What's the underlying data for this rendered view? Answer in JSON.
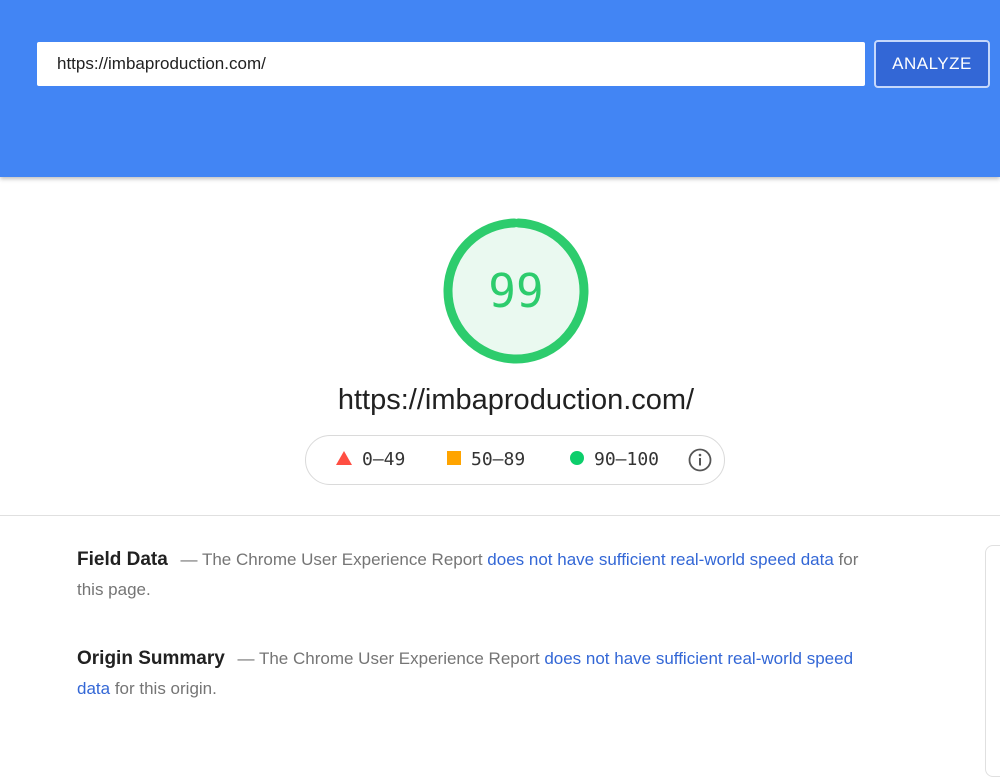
{
  "search": {
    "url_value": "https://imbaproduction.com/",
    "analyze_label": "ANALYZE"
  },
  "score": {
    "value": "99",
    "fraction": 0.99,
    "url": "https://imbaproduction.com/",
    "color": "#0cce6b"
  },
  "legend": {
    "items": [
      {
        "label": "0–49",
        "icon": "triangle-icon",
        "color": "#ff4e42"
      },
      {
        "label": "50–89",
        "icon": "square-icon",
        "color": "#ffa400"
      },
      {
        "label": "90–100",
        "icon": "circle-icon",
        "color": "#0cce6b"
      }
    ],
    "info_icon": "info-icon"
  },
  "field_data": {
    "title": "Field Data",
    "text_before": " — The Chrome User Experience Report ",
    "link": "does not have sufficient real-world speed data",
    "text_after": " for this page."
  },
  "origin_summary": {
    "title": "Origin Summary",
    "text_before": " — The Chrome User Experience Report ",
    "link": "does not have sufficient real-world speed data",
    "text_after": " for this origin."
  },
  "colors": {
    "header": "#4285f4",
    "button": "#3367d6",
    "link": "#3367d6"
  }
}
